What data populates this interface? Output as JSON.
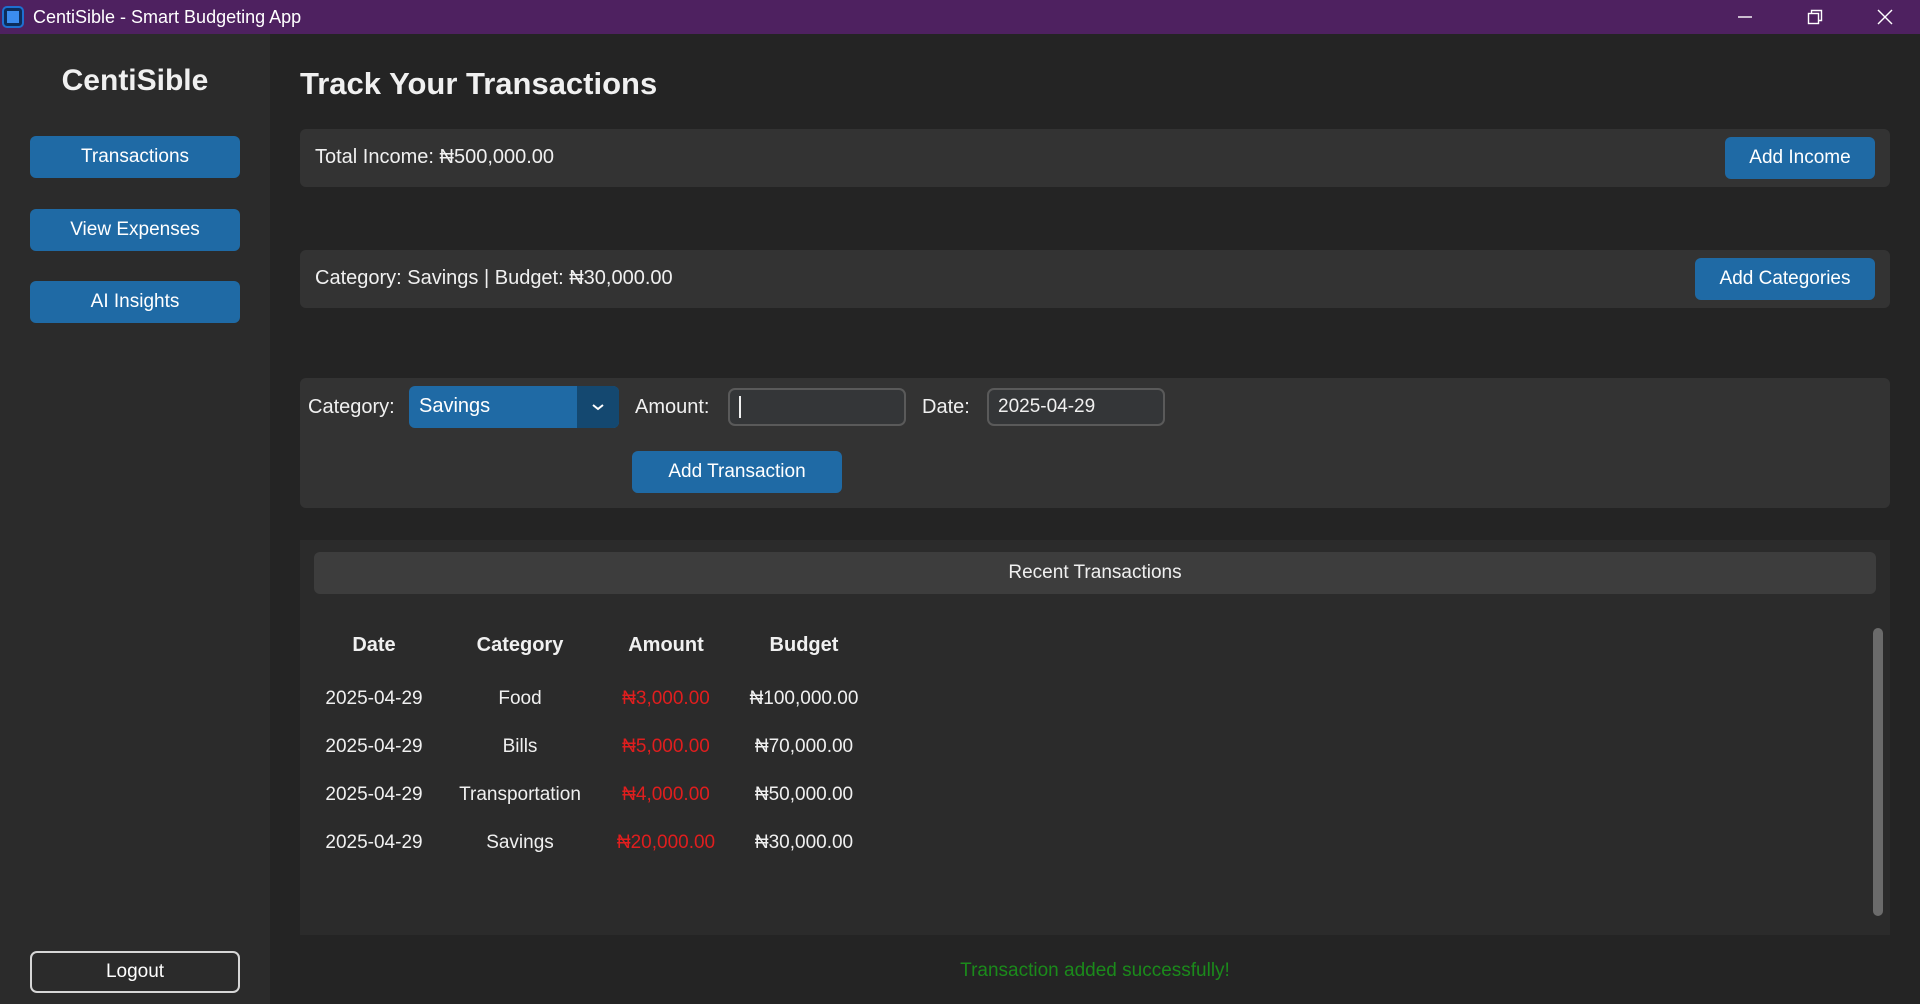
{
  "window": {
    "title": "CentiSible - Smart Budgeting App"
  },
  "sidebar": {
    "brand": "CentiSible",
    "items": [
      {
        "label": "Transactions"
      },
      {
        "label": "View Expenses"
      },
      {
        "label": "AI Insights"
      }
    ],
    "logout_label": "Logout"
  },
  "main": {
    "title": "Track Your Transactions",
    "income": {
      "text": "Total Income: ₦500,000.00",
      "button": "Add Income"
    },
    "category": {
      "text": "Category: Savings | Budget: ₦30,000.00",
      "button": "Add Categories"
    },
    "form": {
      "category_label": "Category:",
      "category_value": "Savings",
      "amount_label": "Amount:",
      "amount_value": "",
      "date_label": "Date:",
      "date_value": "2025-04-29",
      "submit": "Add Transaction"
    },
    "recent": {
      "title": "Recent Transactions",
      "columns": [
        "Date",
        "Category",
        "Amount",
        "Budget"
      ],
      "rows": [
        {
          "date": "2025-04-29",
          "category": "Food",
          "amount": "₦3,000.00",
          "budget": "₦100,000.00"
        },
        {
          "date": "2025-04-29",
          "category": "Bills",
          "amount": "₦5,000.00",
          "budget": "₦70,000.00"
        },
        {
          "date": "2025-04-29",
          "category": "Transportation",
          "amount": "₦4,000.00",
          "budget": "₦50,000.00"
        },
        {
          "date": "2025-04-29",
          "category": "Savings",
          "amount": "₦20,000.00",
          "budget": "₦30,000.00"
        }
      ]
    },
    "status": "Transaction added successfully!"
  },
  "colors": {
    "accent": "#1f6aa5",
    "titlebar": "#4e2160",
    "expense": "#e01e1e",
    "success": "#1b8a1b"
  },
  "icons": [
    "app-icon",
    "minimize-icon",
    "restore-icon",
    "close-icon",
    "chevron-down-icon"
  ]
}
